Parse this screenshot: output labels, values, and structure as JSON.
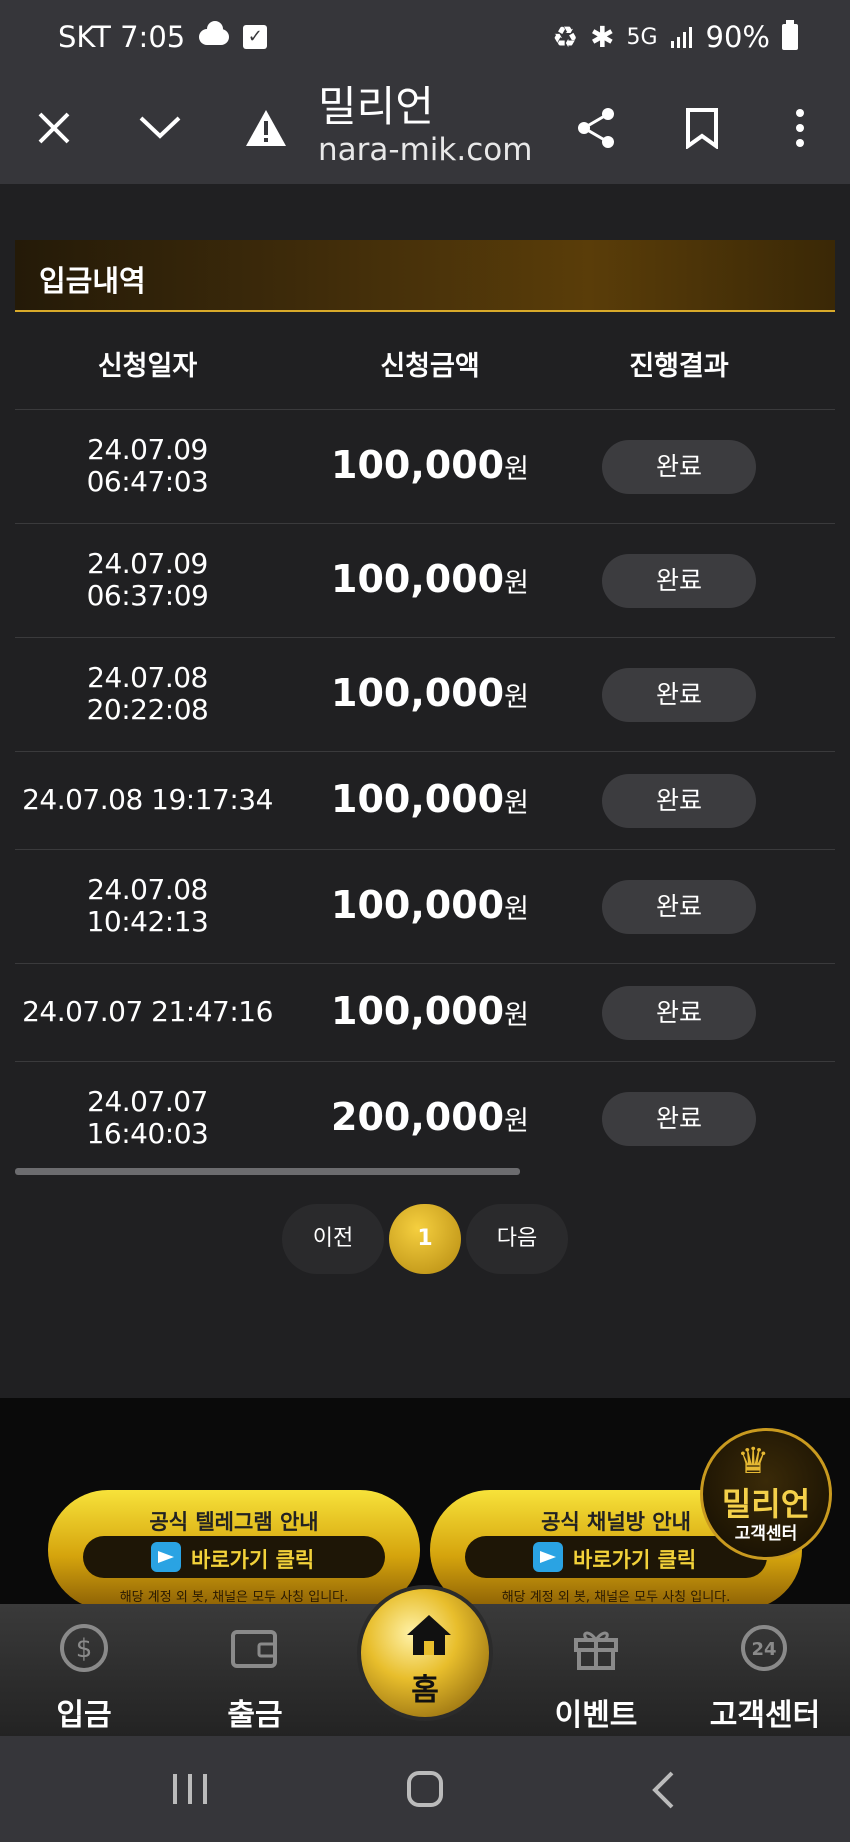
{
  "status_bar": {
    "carrier_time": "SKT 7:05",
    "network": "5G",
    "battery": "90%"
  },
  "browser": {
    "site_name": "밀리언",
    "url": "nara-mik.com"
  },
  "panel": {
    "title": "입금내역"
  },
  "table": {
    "headers": [
      "신청일자",
      "신청금액",
      "진행결과"
    ],
    "rows": [
      {
        "date": "24.07.09",
        "time": "06:47:03",
        "amount": "100,000",
        "unit": "원",
        "status": "완료"
      },
      {
        "date": "24.07.09",
        "time": "06:37:09",
        "amount": "100,000",
        "unit": "원",
        "status": "완료"
      },
      {
        "date": "24.07.08",
        "time": "20:22:08",
        "amount": "100,000",
        "unit": "원",
        "status": "완료"
      },
      {
        "date": "24.07.08 19:17:34",
        "time": "",
        "amount": "100,000",
        "unit": "원",
        "status": "완료"
      },
      {
        "date": "24.07.08",
        "time": "10:42:13",
        "amount": "100,000",
        "unit": "원",
        "status": "완료"
      },
      {
        "date": "24.07.07 21:47:16",
        "time": "",
        "amount": "100,000",
        "unit": "원",
        "status": "완료"
      },
      {
        "date": "24.07.07",
        "time": "16:40:03",
        "amount": "200,000",
        "unit": "원",
        "status": "완료"
      }
    ]
  },
  "pagination": {
    "prev": "이전",
    "current": "1",
    "next": "다음"
  },
  "banners": [
    {
      "title": "공식 텔레그램 안내",
      "button": "바로가기 클릭",
      "note": "해당 계정 외 봇, 채널은 모두 사칭 입니다."
    },
    {
      "title": "공식 채널방 안내",
      "button": "바로가기 클릭",
      "note": "해당 계정 외 봇, 채널은 모두 사칭 입니다."
    }
  ],
  "support_badge": {
    "brand": "밀리언",
    "label": "고객센터"
  },
  "bottom_nav": {
    "deposit": "입금",
    "withdraw": "출금",
    "home": "홈",
    "event": "이벤트",
    "support": "고객센터"
  },
  "colors": {
    "accent_gold": "#d9aa2a",
    "background": "#202022",
    "bar": "#36363a"
  }
}
